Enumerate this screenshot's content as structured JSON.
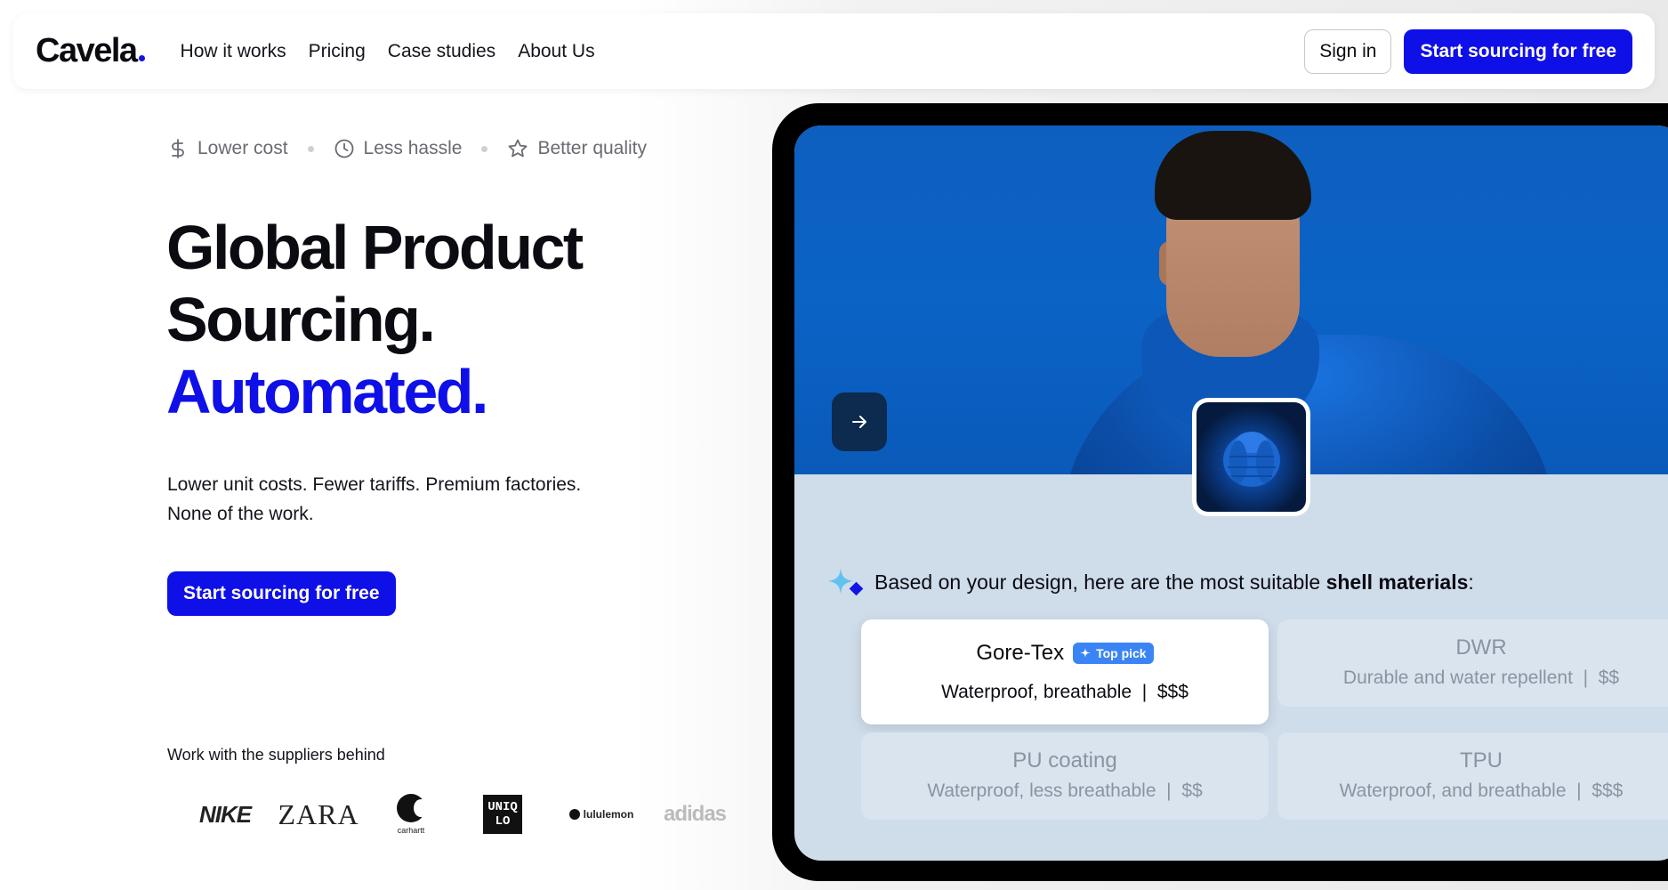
{
  "nav": {
    "logo": "Cavela",
    "links": [
      "How it works",
      "Pricing",
      "Case studies",
      "About Us"
    ],
    "sign_in": "Sign in",
    "cta": "Start sourcing for free"
  },
  "benefits": [
    {
      "icon": "dollar-icon",
      "label": "Lower cost"
    },
    {
      "icon": "clock-icon",
      "label": "Less hassle"
    },
    {
      "icon": "star-icon",
      "label": "Better quality"
    }
  ],
  "hero": {
    "line1": "Global Product",
    "line2": "Sourcing.",
    "line3": "Automated.",
    "sub1": "Lower unit costs. Fewer tariffs. Premium factories.",
    "sub2": "None of the work.",
    "cta": "Start sourcing for free"
  },
  "suppliers": {
    "label": "Work with the suppliers behind",
    "brands": [
      "NIKE",
      "ZARA",
      "carhartt",
      "UNIQLO",
      "lululemon",
      "adidas"
    ]
  },
  "demo": {
    "ai_prefix": "Based on your design, here are the most suitable ",
    "ai_bold": "shell materials",
    "ai_suffix": ":",
    "materials": [
      {
        "name": "Gore-Tex",
        "badge": "Top pick",
        "desc": "Waterproof, breathable",
        "price": "$$$"
      },
      {
        "name": "DWR",
        "desc": "Durable and water repellent",
        "price": "$$"
      },
      {
        "name": "PU coating",
        "desc": "Waterproof, less breathable",
        "price": "$$"
      },
      {
        "name": "TPU",
        "desc": "Waterproof, and breathable",
        "price": "$$$"
      }
    ]
  },
  "colors": {
    "accent": "#0f0fe8",
    "badge": "#3b84f5",
    "panel": "#cfdcea"
  }
}
